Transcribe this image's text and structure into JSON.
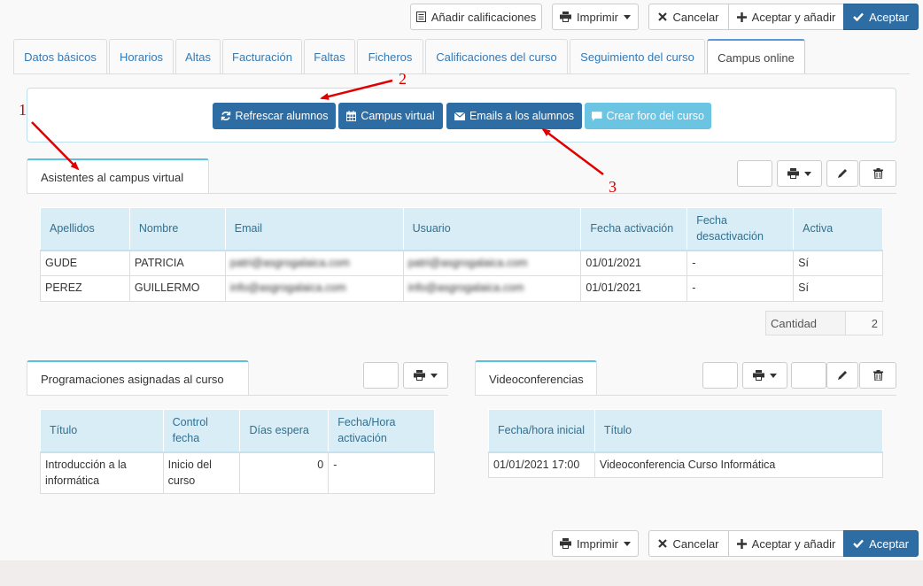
{
  "toolbar": {
    "add_grades": "Añadir calificaciones",
    "print": "Imprimir",
    "cancel": "Cancelar",
    "accept_add": "Aceptar y añadir",
    "accept": "Aceptar"
  },
  "tabs": [
    {
      "label": "Datos básicos"
    },
    {
      "label": "Horarios"
    },
    {
      "label": "Altas"
    },
    {
      "label": "Facturación"
    },
    {
      "label": "Faltas"
    },
    {
      "label": "Ficheros"
    },
    {
      "label": "Calificaciones del curso"
    },
    {
      "label": "Seguimiento del curso"
    },
    {
      "label": "Campus online"
    }
  ],
  "actions": {
    "refresh": "Refrescar alumnos",
    "campus": "Campus virtual",
    "emails": "Emails a los alumnos",
    "forum": "Crear foro del curso"
  },
  "annotations": {
    "a1": "1",
    "a2": "2",
    "a3": "3"
  },
  "attendees": {
    "tab": "Asistentes al campus virtual",
    "headers": [
      "Apellidos",
      "Nombre",
      "Email",
      "Usuario",
      "Fecha activación",
      "Fecha desactivación",
      "Activa"
    ],
    "rows": [
      [
        "GUDE",
        "PATRICIA",
        "patri@asgrogalaica.com",
        "patri@asgrogalaica.com",
        "01/01/2021",
        "-",
        "Sí"
      ],
      [
        "PEREZ",
        "GUILLERMO",
        "info@asgrogalaica.com",
        "info@asgrogalaica.com",
        "01/01/2021",
        "-",
        "Sí"
      ]
    ],
    "quantity_label": "Cantidad",
    "quantity_value": "2"
  },
  "programs": {
    "tab": "Programaciones asignadas al curso",
    "headers": [
      "Título",
      "Control fecha",
      "Días espera",
      "Fecha/Hora activación"
    ],
    "rows": [
      [
        "Introducción a la informática",
        "Inicio del curso",
        "0",
        "-"
      ]
    ]
  },
  "videoconf": {
    "tab": "Videoconferencias",
    "headers": [
      "Fecha/hora inicial",
      "Título"
    ],
    "rows": [
      [
        "01/01/2021 17:00",
        "Videoconferencia Curso Informática"
      ]
    ]
  },
  "colors": {
    "primary": "#2e6da4",
    "info": "#5bc0de",
    "header_bg": "#d9edf7",
    "annotation": "#d40000"
  }
}
